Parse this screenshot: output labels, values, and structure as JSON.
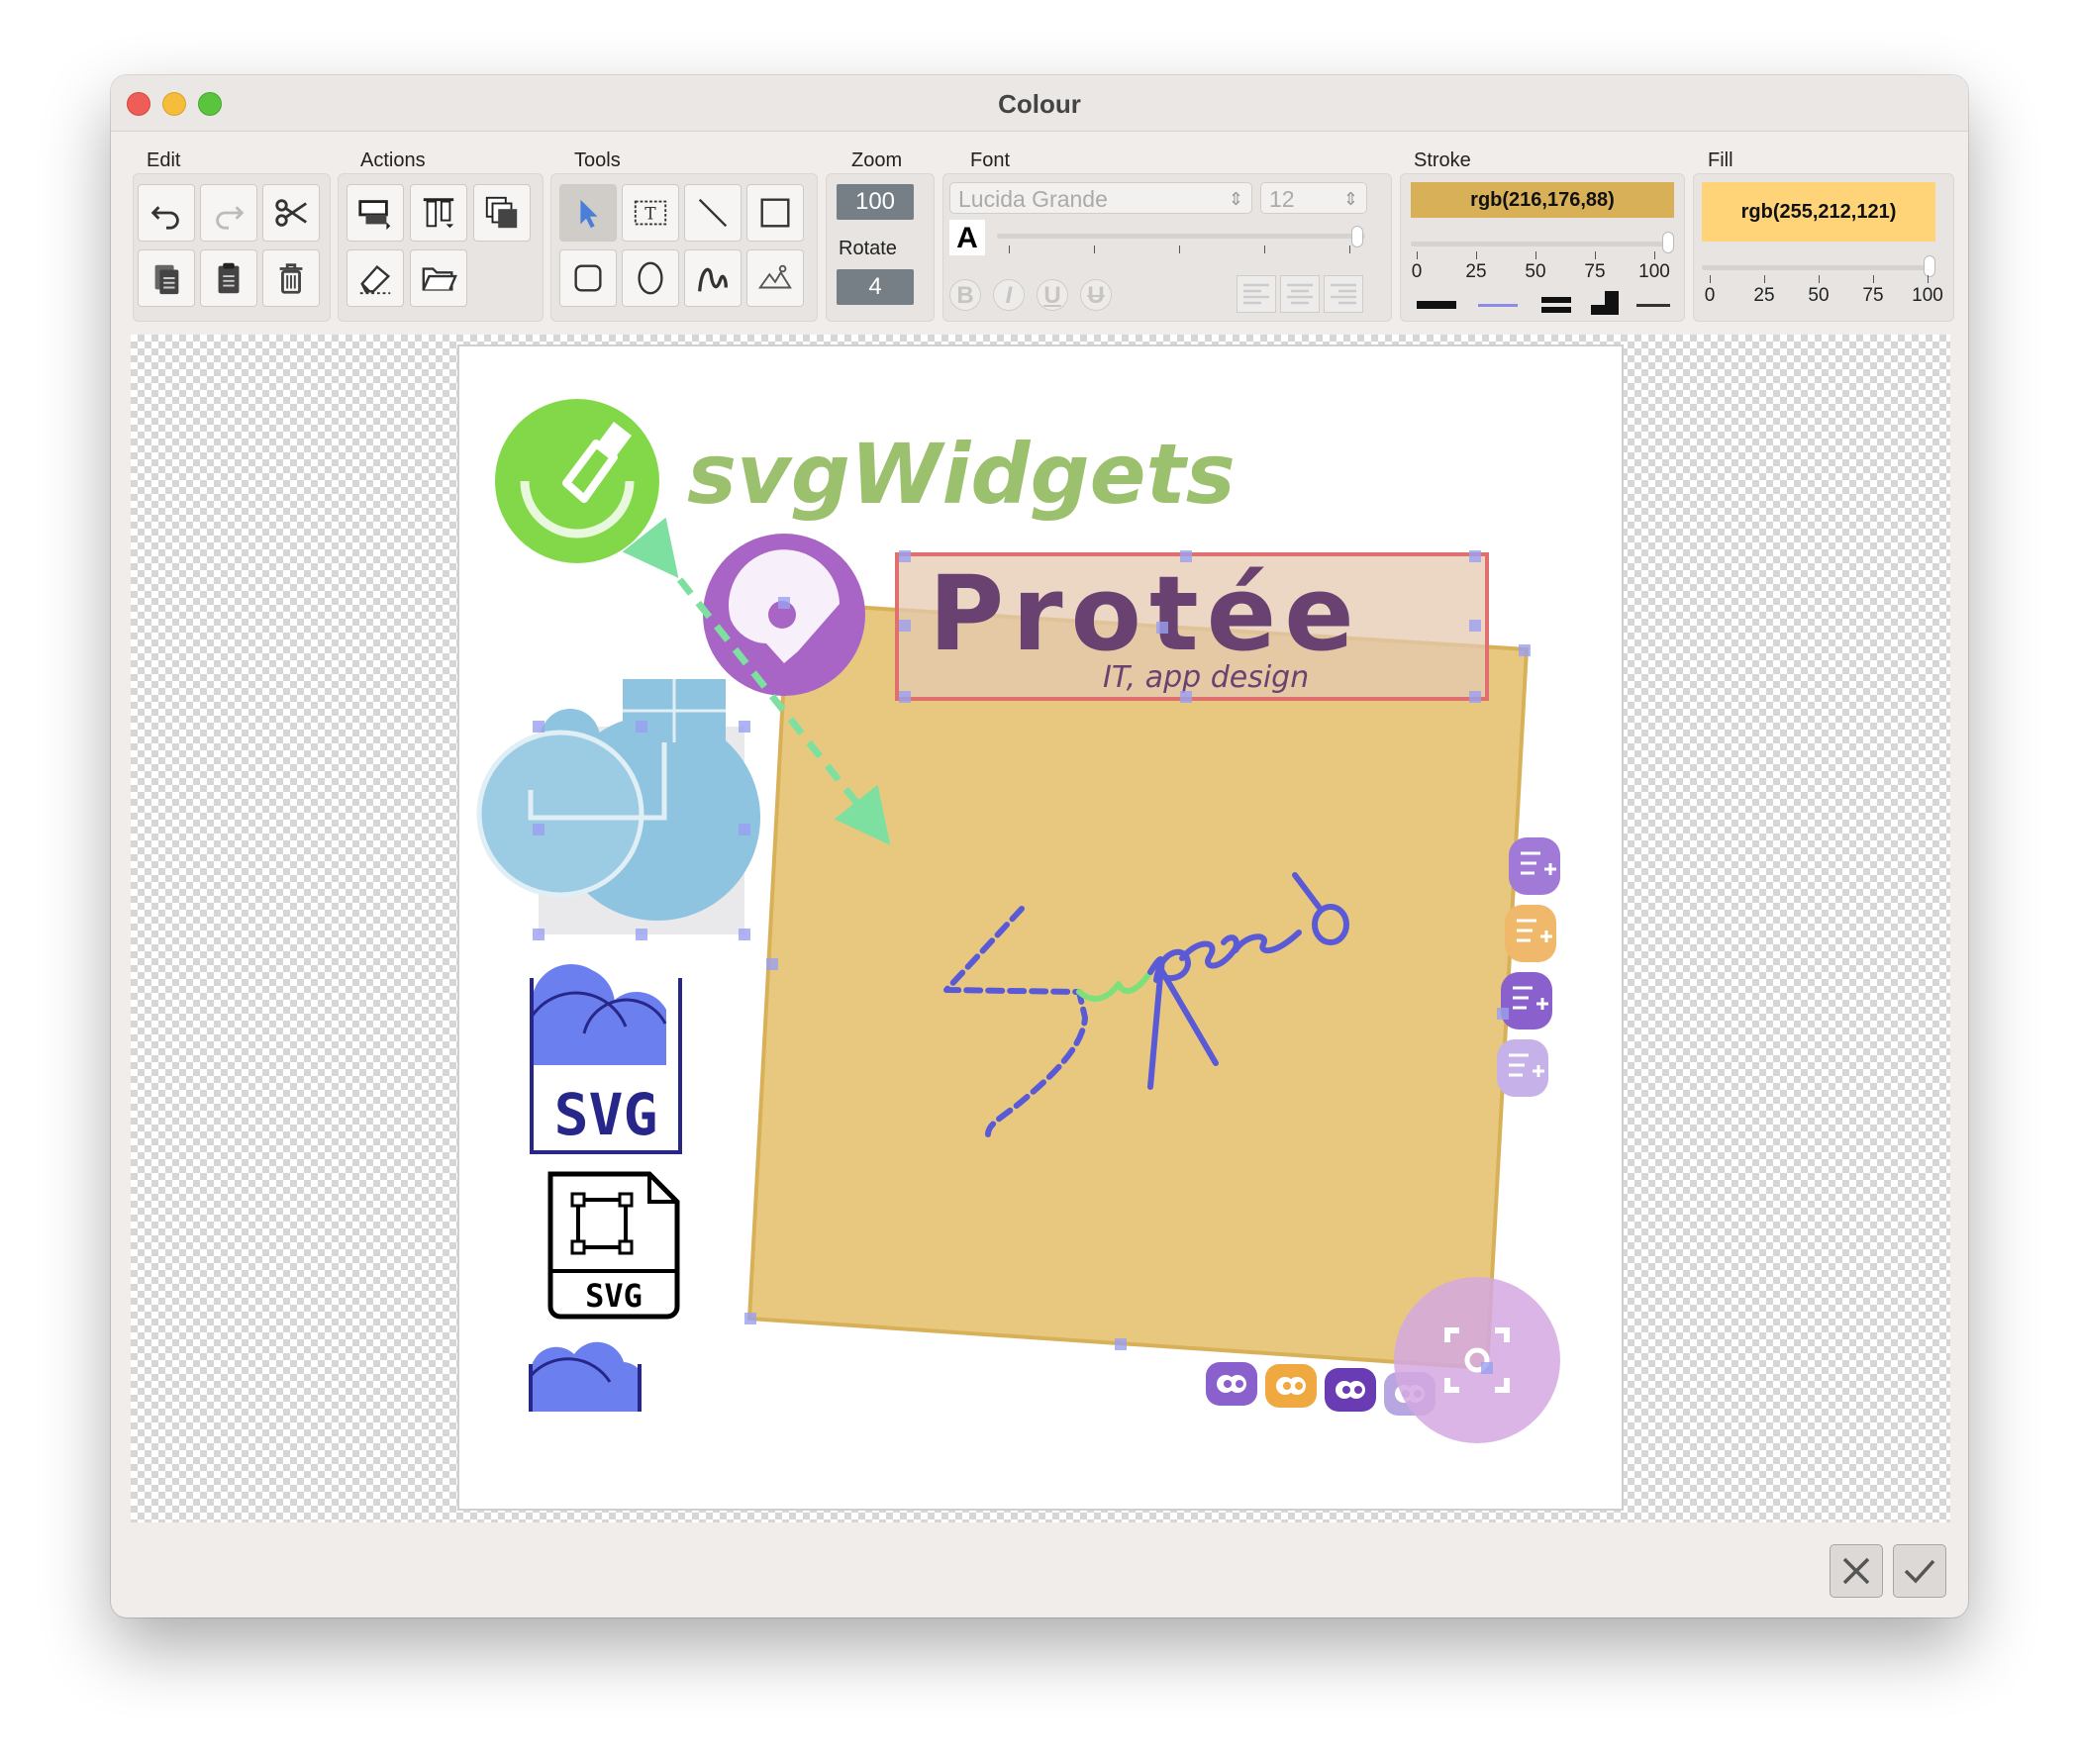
{
  "window": {
    "title": "Colour"
  },
  "toolbar": {
    "groups": {
      "edit": "Edit",
      "actions": "Actions",
      "tools": "Tools",
      "zoom": "Zoom",
      "rotate": "Rotate",
      "font": "Font",
      "stroke": "Stroke",
      "fill": "Fill"
    },
    "zoom_value": "100",
    "rotate_value": "4",
    "font_family": "Lucida Grande",
    "font_size": "12",
    "font_color_letter": "A",
    "format": {
      "bold": "B",
      "italic": "I",
      "underline": "U",
      "strike": "U"
    },
    "stroke_color": "rgb(216,176,88)",
    "stroke_swatch": "#d8b058",
    "fill_color": "rgb(255,212,121)",
    "fill_swatch": "#ffd479",
    "stroke_ticks": [
      "0",
      "25",
      "50",
      "75",
      "100"
    ],
    "fill_ticks": [
      "0",
      "25",
      "50",
      "75",
      "100"
    ],
    "stroke_opacity": 1.0,
    "fill_opacity": 1.0
  },
  "canvas": {
    "logo_text": "svgWidgets",
    "brand_text": "Protée",
    "brand_subtitle": "IT, app design",
    "svg_label": "SVG",
    "svg_file_label": "SVG",
    "handwriting": "Super !",
    "colors": {
      "green": "#82d848",
      "purple": "#a865c5",
      "orange": "#e8c87f",
      "blue": "#5a5ad6",
      "light_blue": "#8ec4df"
    }
  },
  "icons": {
    "edit": [
      "undo-icon",
      "redo-icon",
      "cut-icon",
      "copy-icon",
      "paste-icon",
      "delete-icon"
    ],
    "actions": [
      "move-to-front-icon",
      "align-icon",
      "duplicate-icon",
      "eraser-icon",
      "open-folder-icon"
    ],
    "tools": [
      "select-arrow-icon",
      "text-tool-icon",
      "line-tool-icon",
      "rectangle-tool-icon",
      "rounded-rect-tool-icon",
      "ellipse-tool-icon",
      "freehand-tool-icon",
      "image-tool-icon"
    ],
    "bottom": [
      "cancel-x-icon",
      "confirm-check-icon"
    ]
  }
}
